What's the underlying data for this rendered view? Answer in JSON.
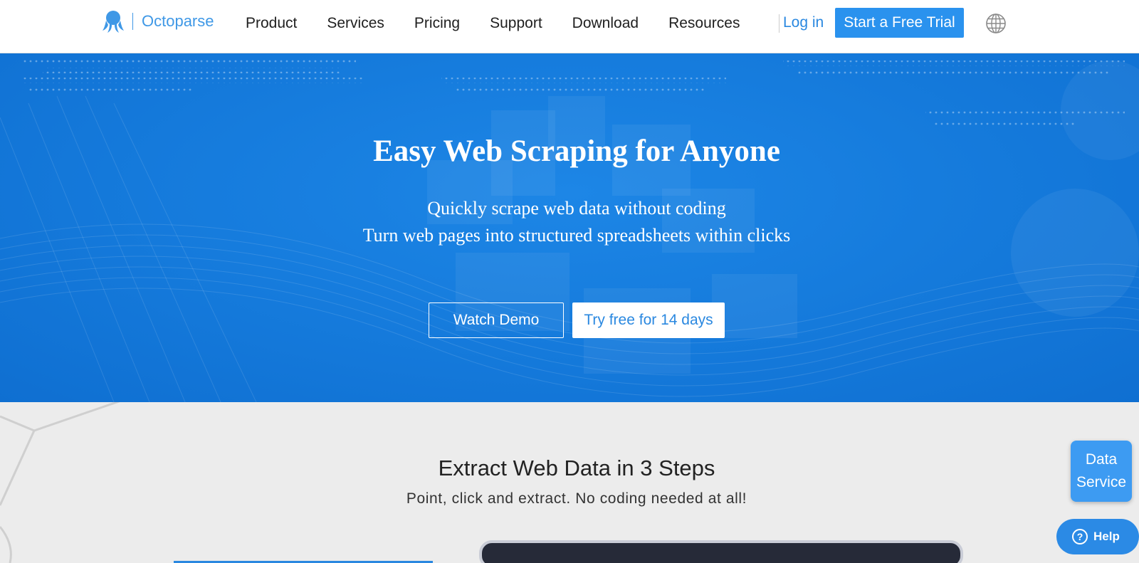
{
  "nav": {
    "brand": "Octoparse",
    "links": [
      "Product",
      "Services",
      "Pricing",
      "Support",
      "Download",
      "Resources"
    ],
    "login": "Log in",
    "cta": "Start a Free Trial",
    "language_icon": "globe-icon"
  },
  "hero": {
    "title": "Easy Web Scraping for Anyone",
    "subtitle_line1": "Quickly scrape web data without coding",
    "subtitle_line2": "Turn web pages into structured spreadsheets within clicks",
    "watch_demo": "Watch Demo",
    "try_free": "Try free for 14 days"
  },
  "steps": {
    "title": "Extract Web Data in 3 Steps",
    "subtitle": "Point, click and extract. No coding needed at all!"
  },
  "floating": {
    "data_service_line1": "Data",
    "data_service_line2": "Service",
    "help": "Help"
  },
  "colors": {
    "brand_blue": "#2a92ee",
    "hero_blue": "#167cdd",
    "section_bg": "#ececec"
  }
}
